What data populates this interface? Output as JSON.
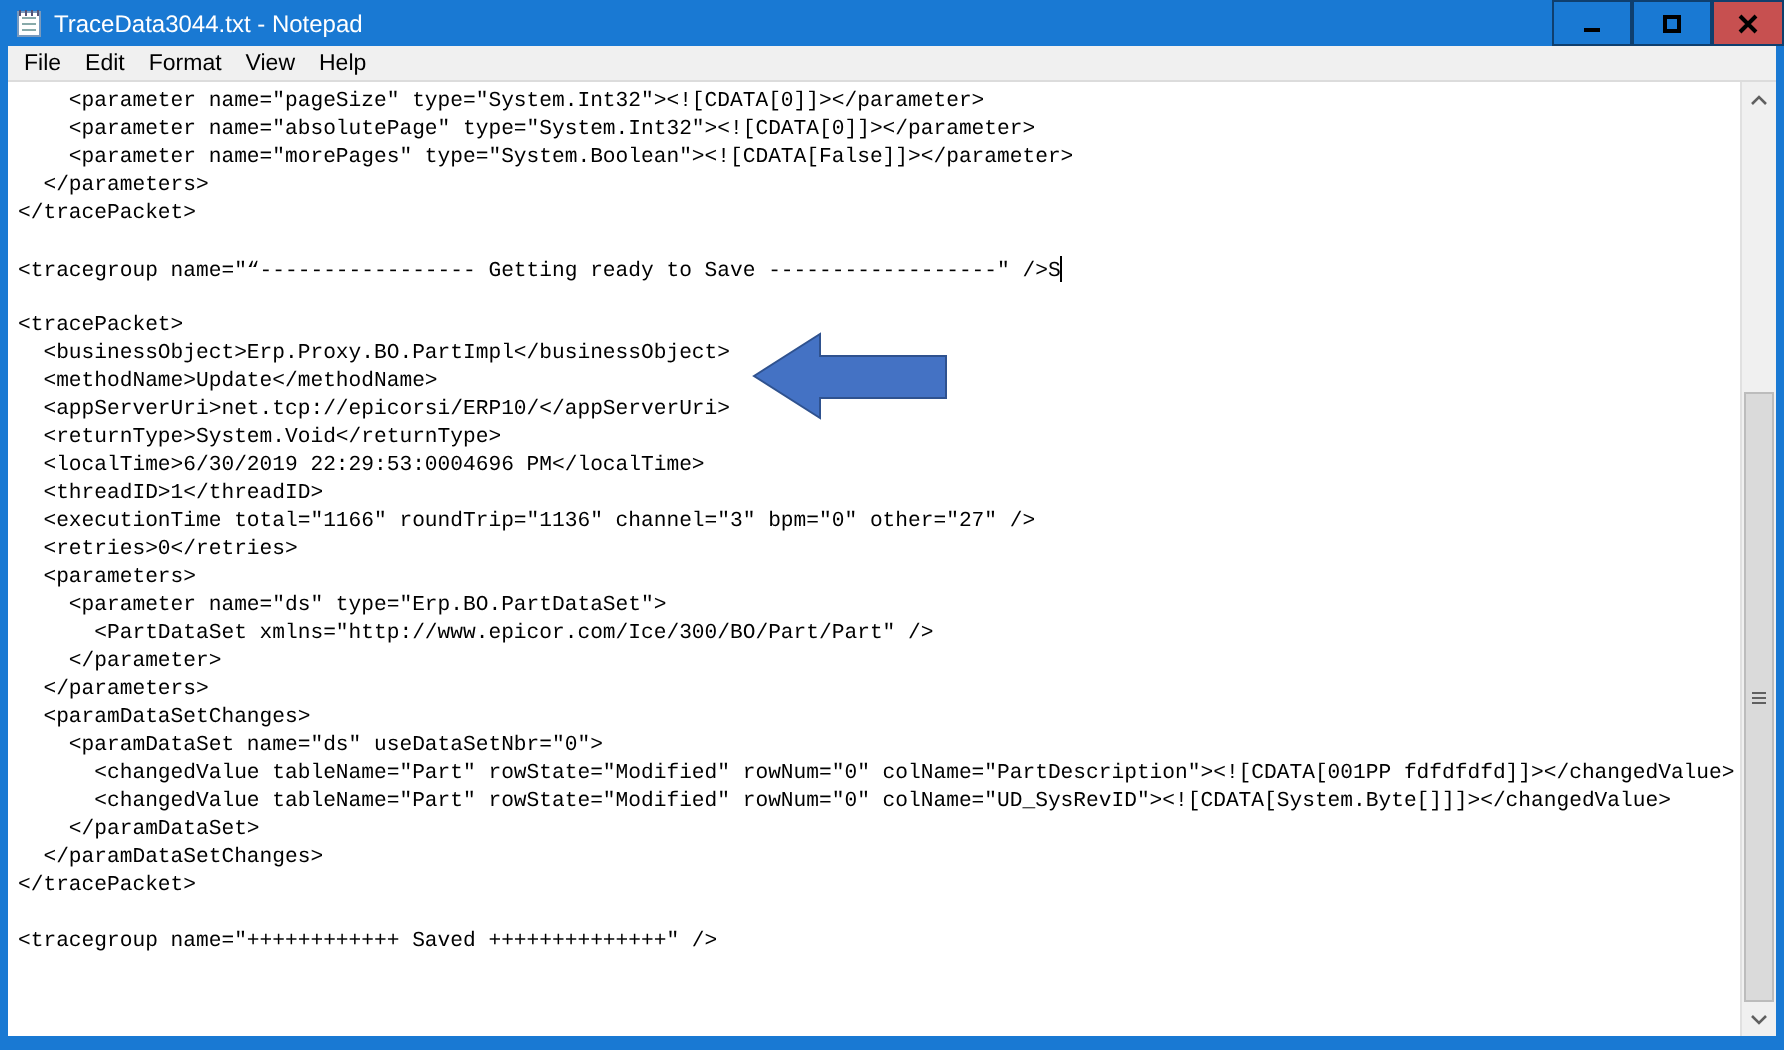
{
  "window": {
    "title": "TraceData3044.txt - Notepad"
  },
  "menu": [
    "File",
    "Edit",
    "Format",
    "View",
    "Help"
  ],
  "lines": [
    {
      "text": "    <parameter name=\"pageSize\" type=\"System.Int32\"><![CDATA[0]]></parameter>",
      "cursor": false
    },
    {
      "text": "    <parameter name=\"absolutePage\" type=\"System.Int32\"><![CDATA[0]]></parameter>",
      "cursor": false
    },
    {
      "text": "    <parameter name=\"morePages\" type=\"System.Boolean\"><![CDATA[False]]></parameter>",
      "cursor": false
    },
    {
      "text": "  </parameters>",
      "cursor": false
    },
    {
      "text": "</tracePacket>",
      "cursor": false
    },
    {
      "cursor": false
    },
    {
      "text": "<tracegroup name=\"“----------------- Getting ready to Save ------------------\" />S",
      "cursor": true
    },
    {
      "cursor": false
    },
    {
      "text": "<tracePacket>",
      "cursor": false
    },
    {
      "text": "  <businessObject>Erp.Proxy.BO.PartImpl</businessObject>",
      "cursor": false
    },
    {
      "text": "  <methodName>Update</methodName>",
      "cursor": false
    },
    {
      "text": "  <appServerUri>net.tcp://epicorsi/ERP10/</appServerUri>",
      "cursor": false
    },
    {
      "text": "  <returnType>System.Void</returnType>",
      "cursor": false
    },
    {
      "text": "  <localTime>6/30/2019 22:29:53:0004696 PM</localTime>",
      "cursor": false
    },
    {
      "text": "  <threadID>1</threadID>",
      "cursor": false
    },
    {
      "text": "  <executionTime total=\"1166\" roundTrip=\"1136\" channel=\"3\" bpm=\"0\" other=\"27\" />",
      "cursor": false
    },
    {
      "text": "  <retries>0</retries>",
      "cursor": false
    },
    {
      "text": "  <parameters>",
      "cursor": false
    },
    {
      "text": "    <parameter name=\"ds\" type=\"Erp.BO.PartDataSet\">",
      "cursor": false
    },
    {
      "text": "      <PartDataSet xmlns=\"http://www.epicor.com/Ice/300/BO/Part/Part\" />",
      "cursor": false
    },
    {
      "text": "    </parameter>",
      "cursor": false
    },
    {
      "text": "  </parameters>",
      "cursor": false
    },
    {
      "text": "  <paramDataSetChanges>",
      "cursor": false
    },
    {
      "text": "    <paramDataSet name=\"ds\" useDataSetNbr=\"0\">",
      "cursor": false
    },
    {
      "text": "      <changedValue tableName=\"Part\" rowState=\"Modified\" rowNum=\"0\" colName=\"PartDescription\"><![CDATA[001PP fdfdfdfd]]></changedValue>",
      "cursor": false
    },
    {
      "text": "      <changedValue tableName=\"Part\" rowState=\"Modified\" rowNum=\"0\" colName=\"UD_SysRevID\"><![CDATA[System.Byte[]]]></changedValue>",
      "cursor": false
    },
    {
      "text": "    </paramDataSet>",
      "cursor": false
    },
    {
      "text": "  </paramDataSetChanges>",
      "cursor": false
    },
    {
      "text": "</tracePacket>",
      "cursor": false
    },
    {
      "cursor": false
    },
    {
      "text": "<tracegroup name=\"++++++++++++ Saved ++++++++++++++\" />",
      "cursor": false
    }
  ]
}
